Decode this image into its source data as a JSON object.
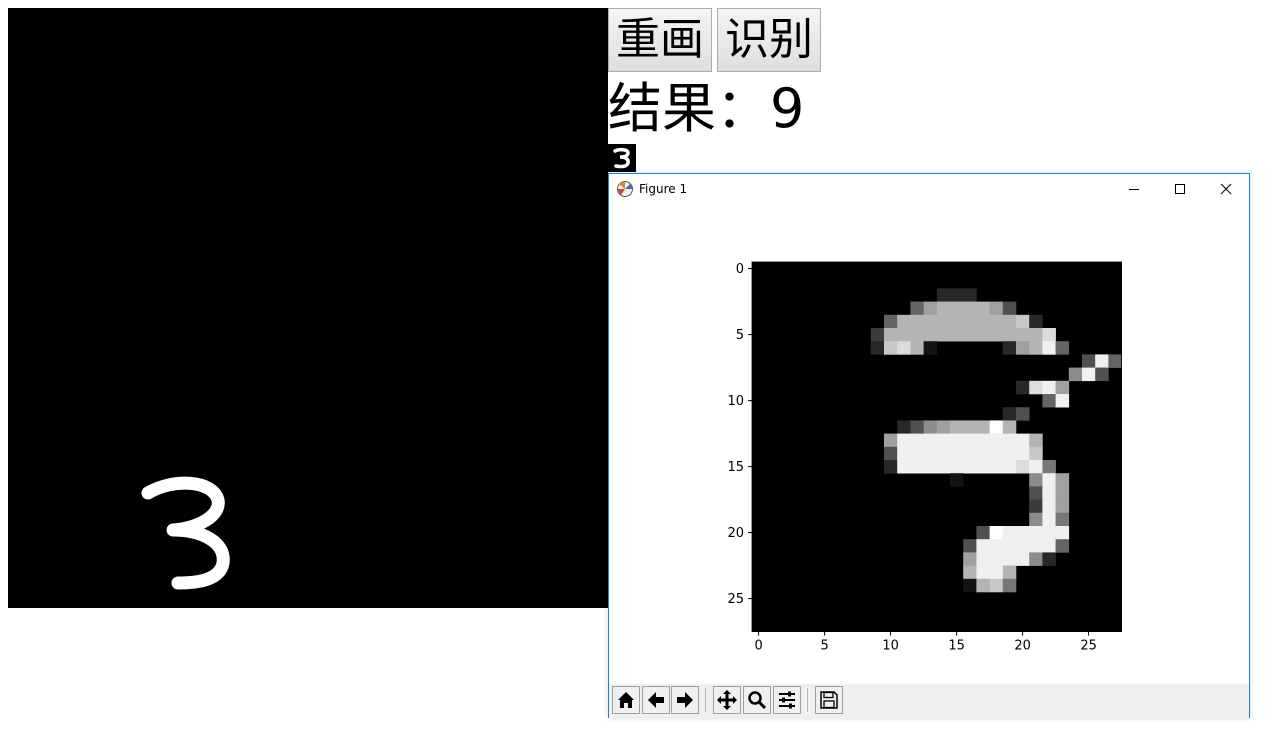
{
  "buttons": {
    "redraw": "重画",
    "recognize": "识别"
  },
  "result": {
    "label": "结果：",
    "value": "9",
    "text": "结果：9"
  },
  "figure_window": {
    "title": "Figure 1",
    "toolbar_icons": [
      "home-icon",
      "back-arrow-icon",
      "forward-arrow-icon",
      "pan-icon",
      "zoom-icon",
      "configure-subplots-icon",
      "save-icon"
    ]
  },
  "chart_data": {
    "type": "heatmap",
    "colormap": "gray",
    "xlim": [
      -0.5,
      27.5
    ],
    "ylim": [
      27.5,
      -0.5
    ],
    "xticks": [
      0,
      5,
      10,
      15,
      20,
      25
    ],
    "yticks": [
      0,
      5,
      10,
      15,
      20,
      25
    ],
    "xtick_labels": [
      "0",
      "5",
      "10",
      "15",
      "20",
      "25"
    ],
    "ytick_labels": [
      "0",
      "5",
      "10",
      "15",
      "20",
      "25"
    ],
    "grid": false,
    "pixels": [
      "............................",
      "............................",
      "..............222...........",
      "............58999984........",
      "..........5999999999a2......",
      ".........3999999999999b.....",
      ".........2ab91.....289c5....",
      ".........................4c5",
      "........................7c4.",
      "....................2bc8....",
      "......................5c....",
      "...................24.......",
      "...........2478999d9........",
      "..........8cccccccccc9......",
      "..........4cccccccccca......",
      "..........2cccccccccbc6.....",
      "...............1.....7c8....",
      ".....................4c8....",
      ".....................3c8....",
      ".....................7c6....",
      ".................4dccccc....",
      "................4cccccc5....",
      "................8cccc72.....",
      "................9cc9........",
      "................19a6........",
      "............................",
      "............................",
      "............................"
    ]
  }
}
